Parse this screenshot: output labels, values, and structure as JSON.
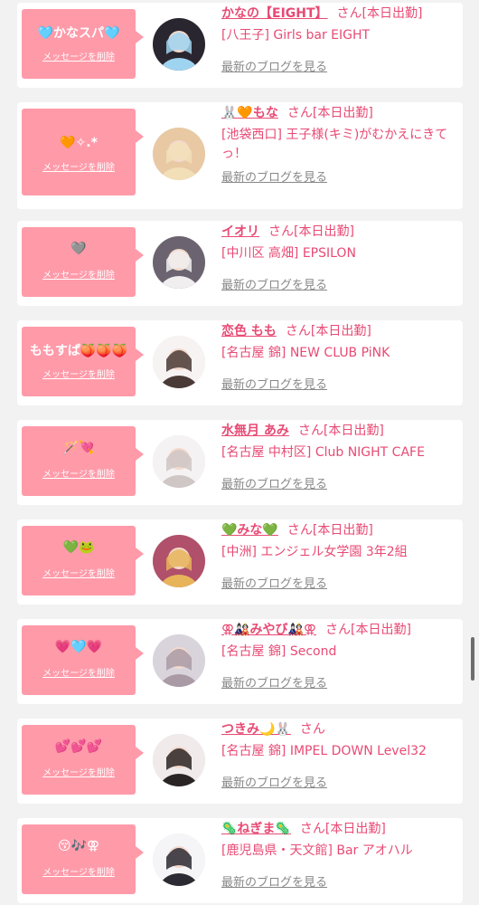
{
  "entries": [
    {
      "message": "🩵かなスパ🩵",
      "delete_label": "メッセージを削除",
      "name": "かなの【EIGHT】",
      "san": "さん[本日出勤]",
      "shop": "[八王子] Girls bar EIGHT",
      "blog_label": "最新のブログを見る",
      "avatar": {
        "bg": "#2a2630",
        "accent": "#9fd4f0"
      }
    },
    {
      "message": "🧡✧.*",
      "delete_label": "メッセージを削除",
      "name": "🐰🧡もな",
      "san": "さん[本日出勤]",
      "shop": "[池袋西口] 王子様(キミ)がむかえにきてっ！",
      "blog_label": "最新のブログを見る",
      "avatar": {
        "bg": "#e8c9a3",
        "accent": "#f2dfb8"
      }
    },
    {
      "message": "🩶",
      "delete_label": "メッセージを削除",
      "name": "イオリ",
      "san": "さん[本日出勤]",
      "shop": "[中川区 高畑] EPSILON",
      "blog_label": "最新のブログを見る",
      "avatar": {
        "bg": "#6b6470",
        "accent": "#f0eeee"
      }
    },
    {
      "message": "ももすぱ🍑🍑🍑",
      "delete_label": "メッセージを削除",
      "name": "恋色 もも",
      "san": "さん[本日出勤]",
      "shop": "[名古屋 錦] NEW CLUB PiNK",
      "blog_label": "最新のブログを見る",
      "avatar": {
        "bg": "#f7f3f3",
        "accent": "#4a3a36"
      }
    },
    {
      "message": "🪄💘",
      "delete_label": "メッセージを削除",
      "name": "水無月 あみ",
      "san": "さん[本日出勤]",
      "shop": "[名古屋 中村区] Club NIGHT CAFE",
      "blog_label": "最新のブログを見る",
      "avatar": {
        "bg": "#f4f2f2",
        "accent": "#cfc6c6"
      }
    },
    {
      "message": "💚🐸",
      "delete_label": "メッセージを削除",
      "name": "💚みな💚",
      "san": "さん[本日出勤]",
      "shop": "[中洲] エンジェル女学園 3年2組",
      "blog_label": "最新のブログを見る",
      "avatar": {
        "bg": "#b0506a",
        "accent": "#e8b45a"
      }
    },
    {
      "message": "💗🩵💗",
      "delete_label": "メッセージを削除",
      "name": "⚢🎎みやび🎎⚢",
      "san": "さん[本日出勤]",
      "shop": "[名古屋 錦] Second",
      "blog_label": "最新のブログを見る",
      "avatar": {
        "bg": "#d9d4dc",
        "accent": "#a99aa6"
      }
    },
    {
      "message": "💕💕💕",
      "delete_label": "メッセージを削除",
      "name": "つきみ🌙🐰",
      "san": "さん",
      "shop": "[名古屋 錦] IMPEL DOWN Level32",
      "blog_label": "最新のブログを見る",
      "avatar": {
        "bg": "#f0eaea",
        "accent": "#2b2424"
      }
    },
    {
      "message": "😚🎶⚢",
      "delete_label": "メッセージを削除",
      "name": "🦠ねぎま🦠",
      "san": "さん[本日出勤]",
      "shop": "[鹿児島県・天文館] Bar アオハル",
      "blog_label": "最新のブログを見る",
      "avatar": {
        "bg": "#f5f5f8",
        "accent": "#2c2a33"
      }
    }
  ]
}
